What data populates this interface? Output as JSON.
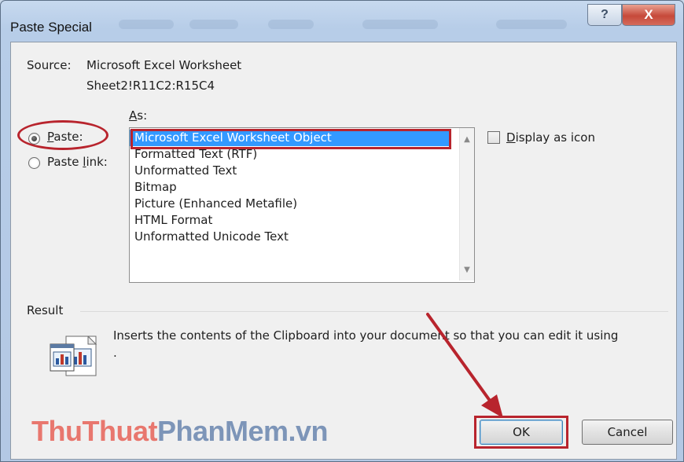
{
  "window": {
    "title": "Paste Special",
    "help_glyph": "?",
    "close_glyph": "X"
  },
  "source": {
    "label": "Source:",
    "value": "Microsoft Excel Worksheet",
    "range": "Sheet2!R11C2:R15C4"
  },
  "options": {
    "paste": {
      "label_access": "P",
      "label_rest": "aste:",
      "checked": true
    },
    "paste_link": {
      "label_prefix": "Paste ",
      "label_access": "l",
      "label_rest": "ink:",
      "checked": false
    }
  },
  "as": {
    "label_access": "A",
    "label_rest": "s:",
    "items": [
      "Microsoft Excel Worksheet Object",
      "Formatted Text (RTF)",
      "Unformatted Text",
      "Bitmap",
      "Picture (Enhanced Metafile)",
      "HTML Format",
      "Unformatted Unicode Text"
    ],
    "selected_index": 0
  },
  "display_as_icon": {
    "label_access": "D",
    "label_rest": "isplay as icon",
    "checked": false
  },
  "result": {
    "label": "Result",
    "text": "Inserts the contents of the Clipboard into your document so that you can edit it using",
    "continuation": "."
  },
  "watermark": {
    "part1": "ThuThuat",
    "part2": "PhanMem.vn"
  },
  "buttons": {
    "ok": "OK",
    "cancel": "Cancel"
  },
  "icons": {
    "help": "help-icon",
    "close": "close-icon",
    "clipboard_result": "clipboard-chart-icon",
    "scroll_up": "scroll-up-icon",
    "scroll_down": "scroll-down-icon"
  },
  "colors": {
    "selection": "#3399ff",
    "annotation_red": "#b8242d",
    "watermark_red": "#e8776e",
    "watermark_blue": "#7d95b8"
  }
}
